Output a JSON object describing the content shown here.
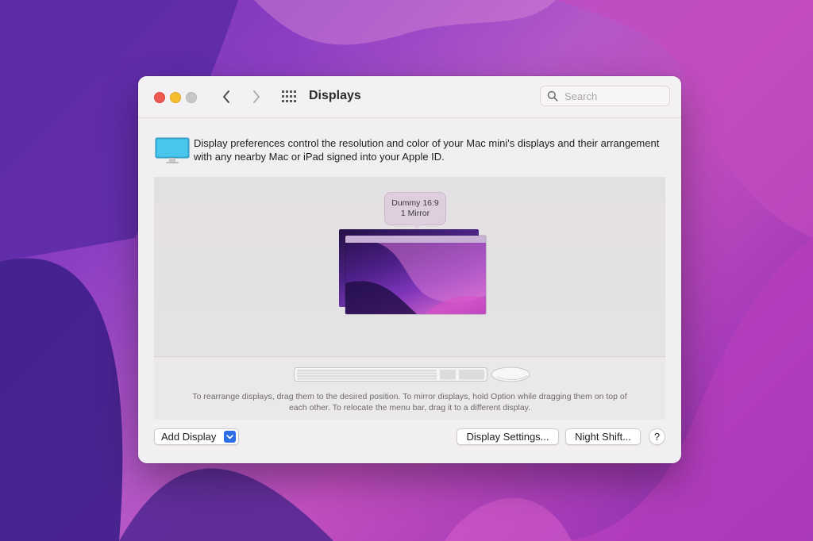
{
  "window": {
    "title": "Displays",
    "search": {
      "placeholder": "Search",
      "value": ""
    }
  },
  "info": {
    "text": "Display preferences control the resolution and color of your Mac mini's displays and their arrangement with any nearby Mac or iPad signed into your Apple ID."
  },
  "arrangement": {
    "tooltip": {
      "line1": "Dummy 16:9",
      "line2": "1 Mirror"
    },
    "hint": "To rearrange displays, drag them to the desired position. To mirror displays, hold Option while dragging them on top of each other. To relocate the menu bar, drag it to a different display."
  },
  "footer": {
    "add_display_label": "Add Display",
    "display_settings_label": "Display Settings...",
    "night_shift_label": "Night Shift...",
    "help_label": "?"
  },
  "colors": {
    "close": "#ee5a52",
    "minimize": "#f5bd2f",
    "zoom_disabled": "#c9c6c9",
    "accent": "#2a6fe6"
  },
  "icons": [
    "close-icon",
    "minimize-icon",
    "zoom-icon",
    "chevron-left-icon",
    "chevron-right-icon",
    "grid-icon",
    "search-icon",
    "display-icon",
    "keyboard-icon",
    "mouse-icon",
    "chevron-down-icon"
  ]
}
